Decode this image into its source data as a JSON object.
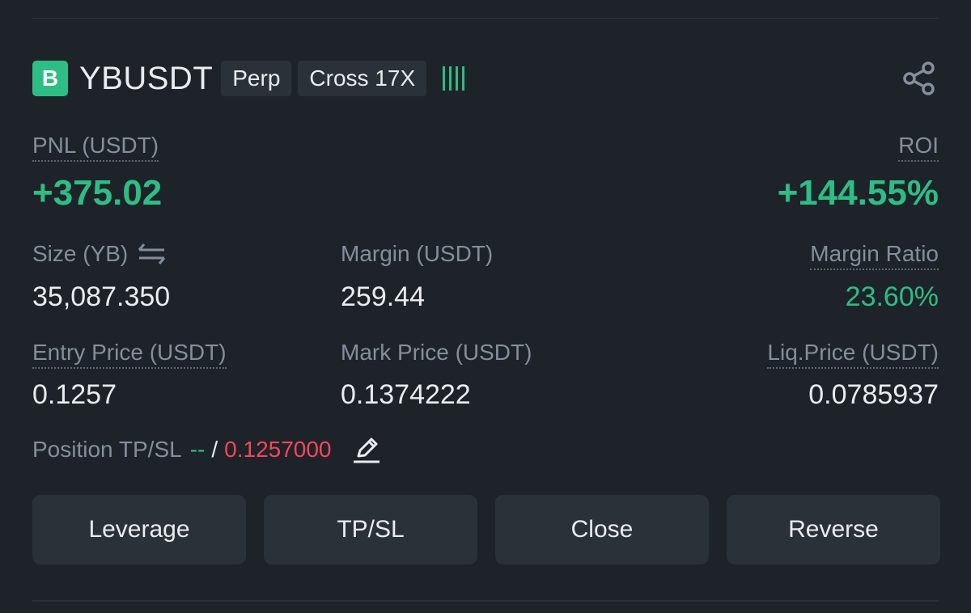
{
  "position": {
    "side_badge": "B",
    "symbol": "YBUSDT",
    "tags": [
      "Perp",
      "Cross 17X"
    ]
  },
  "pnl": {
    "label": "PNL (USDT)",
    "value": "+375.02"
  },
  "roi": {
    "label": "ROI",
    "value": "+144.55%"
  },
  "size": {
    "label": "Size (YB)",
    "value": "35,087.350"
  },
  "margin": {
    "label": "Margin (USDT)",
    "value": "259.44"
  },
  "margin_ratio": {
    "label": "Margin Ratio",
    "value": "23.60%"
  },
  "entry_price": {
    "label": "Entry Price (USDT)",
    "value": "0.1257"
  },
  "mark_price": {
    "label": "Mark Price (USDT)",
    "value": "0.1374222"
  },
  "liq_price": {
    "label": "Liq.Price (USDT)",
    "value": "0.0785937"
  },
  "tpsl": {
    "label": "Position TP/SL",
    "tp": "--",
    "separator": "/",
    "sl": "0.1257000"
  },
  "buttons": {
    "leverage": "Leverage",
    "tpsl": "TP/SL",
    "close": "Close",
    "reverse": "Reverse"
  },
  "colors": {
    "up": "#2ebd85",
    "down": "#f6465d",
    "background": "#1e2329",
    "button": "#2b3139"
  },
  "icons": {
    "share": "share-icon",
    "swap": "swap-arrows-icon",
    "edit": "pencil-edit-icon",
    "bars": "signal-bars-icon"
  }
}
